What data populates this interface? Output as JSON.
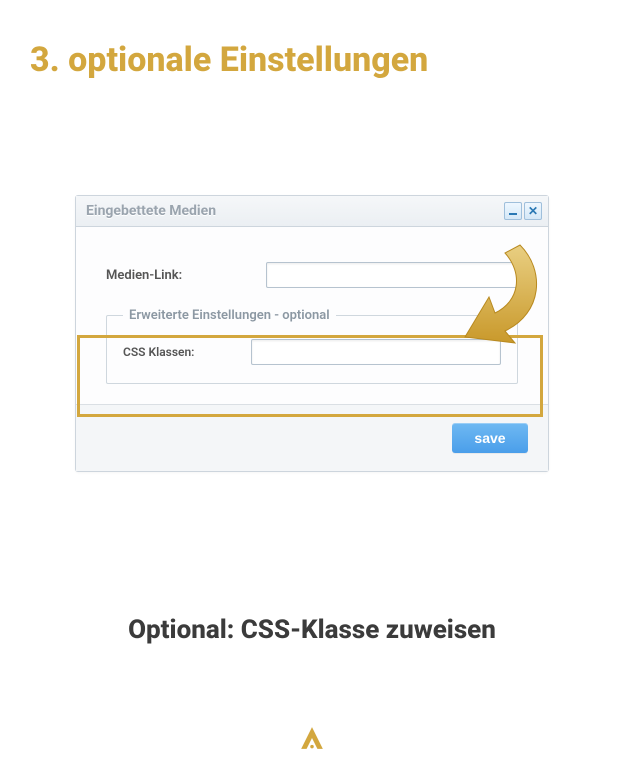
{
  "heading": "3. optionale Einstellungen",
  "dialog": {
    "title": "Eingebettete Medien",
    "media_link_label": "Medien-Link:",
    "media_link_value": "",
    "advanced_legend": "Erweiterte Einstellungen - optional",
    "css_classes_label": "CSS Klassen:",
    "css_classes_value": "",
    "save_button_label": "save"
  },
  "caption": "Optional: CSS-Klasse zuweisen"
}
